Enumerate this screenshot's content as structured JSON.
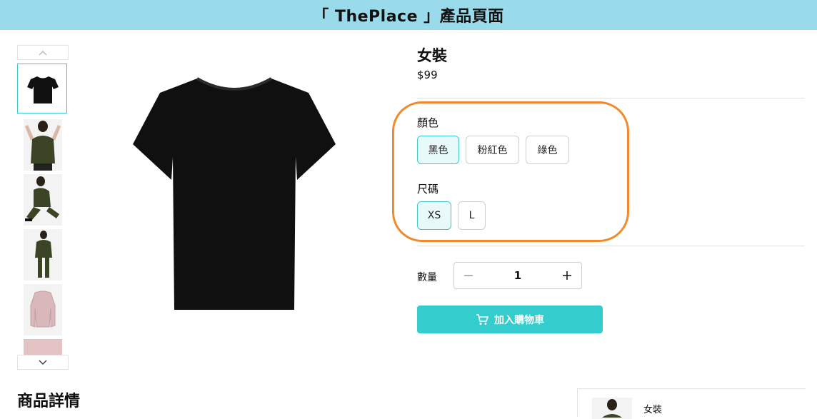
{
  "colors": {
    "header_bg": "#99dbeb",
    "accent": "#34cccc",
    "highlight": "#f08a2c"
  },
  "header": {
    "title": "「 ThePlace 」產品頁面"
  },
  "gallery": {
    "prev_icon": "chevron-up-icon",
    "next_icon": "chevron-down-icon",
    "thumbnails": [
      "black-tshirt",
      "olive-top-model",
      "olive-outfit-sitting",
      "olive-outfit-standing",
      "pink-jacket",
      "pink-fabric"
    ]
  },
  "product": {
    "title": "女裝",
    "price": "$99",
    "color_label": "顏色",
    "colors": [
      "黑色",
      "粉紅色",
      "綠色"
    ],
    "selected_color": "黑色",
    "size_label": "尺碼",
    "sizes": [
      "XS",
      "L"
    ],
    "selected_size": "XS",
    "quantity_label": "數量",
    "quantity": "1",
    "add_to_cart": "加入購物車",
    "cart_icon": "cart-icon"
  },
  "details": {
    "title": "商品詳情"
  },
  "side_card": {
    "name": "女裝"
  }
}
